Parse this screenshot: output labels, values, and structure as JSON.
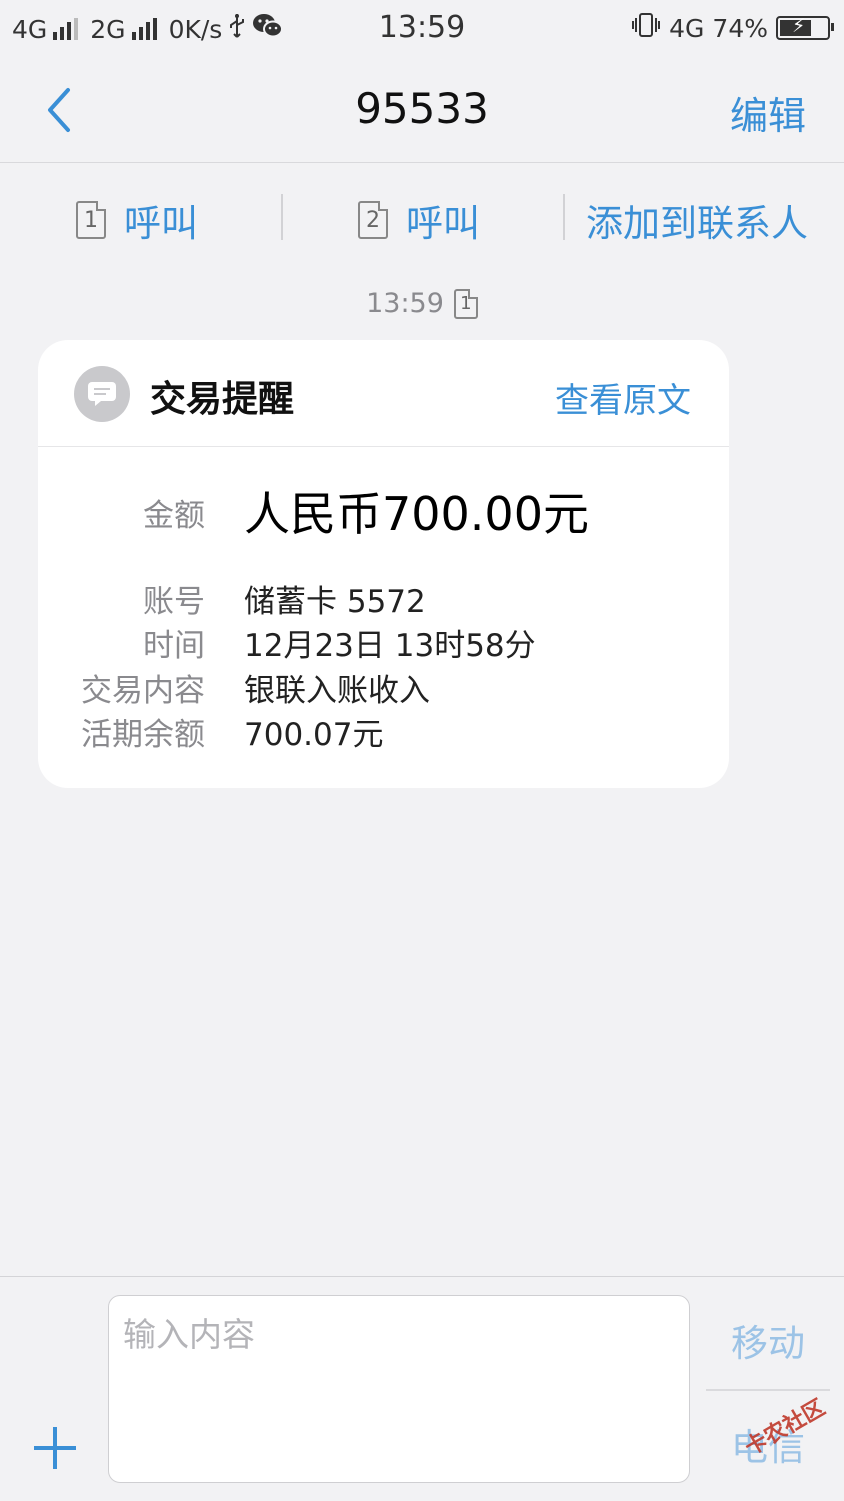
{
  "status_bar": {
    "net1": "4G",
    "net2": "2G",
    "speed": "0K/s",
    "time": "13:59",
    "net3": "4G",
    "battery": "74%",
    "battery_level": 0.74
  },
  "nav": {
    "title": "95533",
    "edit_label": "编辑"
  },
  "actions": {
    "call1_label": "呼叫",
    "sim1": "1",
    "call2_label": "呼叫",
    "sim2": "2",
    "add_contact_label": "添加到联系人"
  },
  "message": {
    "time": "13:59",
    "sim": "1",
    "card": {
      "title": "交易提醒",
      "view_original": "查看原文",
      "rows": [
        {
          "label": "金额",
          "value": "人民币700.00元"
        },
        {
          "label": "账号",
          "value": "储蓄卡 5572"
        },
        {
          "label": "时间",
          "value": "12月23日 13时58分"
        },
        {
          "label": "交易内容",
          "value": "银联入账收入"
        },
        {
          "label": "活期余额",
          "value": "700.07元"
        }
      ]
    }
  },
  "composer": {
    "placeholder": "输入内容",
    "send_mobile": "移动",
    "send_telecom": "电信"
  },
  "watermark": "卡农社区",
  "colors": {
    "accent": "#3a8fd6",
    "background": "#f2f2f4",
    "card": "#ffffff",
    "muted_text": "#8a8a8e"
  }
}
